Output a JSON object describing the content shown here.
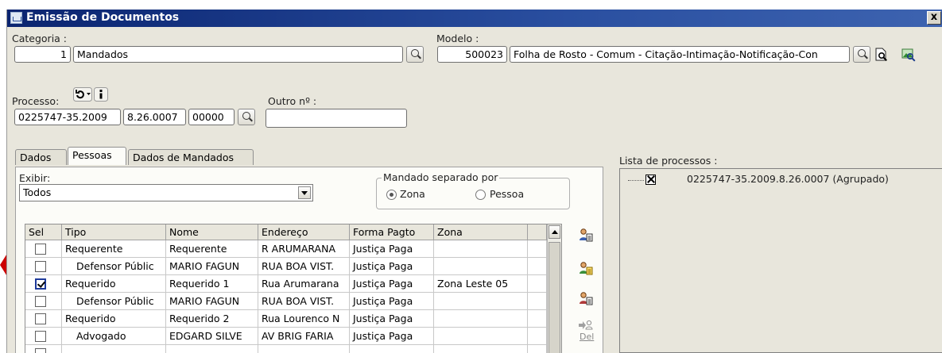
{
  "window": {
    "title": "Emissão de Documentos",
    "close_label": "x"
  },
  "categoria": {
    "label": "Categoria :",
    "code": "1",
    "name": "Mandados"
  },
  "modelo": {
    "label": "Modelo :",
    "code": "500023",
    "name": "Folha de Rosto - Comum - Citação-Intimação-Notificação-Con"
  },
  "processo": {
    "label": "Processo:",
    "part1": "0225747-35.2009",
    "part2": "8.26.0007",
    "part3": "00000"
  },
  "outro": {
    "label": "Outro nº :",
    "value": ""
  },
  "tabs": [
    {
      "label": "Dados"
    },
    {
      "label": "Pessoas"
    },
    {
      "label": "Dados de Mandados"
    }
  ],
  "exibir": {
    "label": "Exibir:",
    "value": "Todos"
  },
  "mandado_separado": {
    "label": "Mandado separado por",
    "options": [
      {
        "label": "Zona",
        "selected": true
      },
      {
        "label": "Pessoa",
        "selected": false
      }
    ]
  },
  "grid": {
    "columns": [
      "Sel",
      "Tipo",
      "Nome",
      "Endereço",
      "Forma Pagto",
      "Zona"
    ],
    "rows": [
      {
        "sel": false,
        "tipo": "Requerente",
        "nome": "Requerente",
        "endereco": "R ARUMARANA",
        "pagto": "Justiça Paga",
        "zona": ""
      },
      {
        "sel": false,
        "tipo": "Defensor Públic",
        "nome": "MARIO FAGUN",
        "endereco": "RUA BOA VIST.",
        "pagto": "Justiça Paga",
        "zona": ""
      },
      {
        "sel": true,
        "tipo": "Requerido",
        "nome": "Requerido 1",
        "endereco": "Rua Arumarana",
        "pagto": "Justiça Paga",
        "zona": "Zona Leste 05"
      },
      {
        "sel": false,
        "tipo": "Defensor Públic",
        "nome": "MARIO FAGUN",
        "endereco": "RUA BOA VIST.",
        "pagto": "Justiça Paga",
        "zona": ""
      },
      {
        "sel": false,
        "tipo": "Requerido",
        "nome": "Requerido 2",
        "endereco": "Rua Lourenco N",
        "pagto": "Justiça Paga",
        "zona": ""
      },
      {
        "sel": false,
        "tipo": "Advogado",
        "nome": "EDGARD SILVE",
        "endereco": "AV BRIG FARIA",
        "pagto": "Justiça Paga",
        "zona": ""
      },
      {
        "sel": false,
        "tipo": "",
        "nome": "",
        "endereco": "",
        "pagto": "",
        "zona": ""
      }
    ]
  },
  "side": {
    "del_label": "Del"
  },
  "lista": {
    "label": "Lista de processos :",
    "item": "0225747-35.2009.8.26.0007 (Agrupado)"
  },
  "colors": {
    "titlebar": "#0a2470",
    "window_bg": "#e8e6dc",
    "arrow": "#cc0000",
    "check_border": "#1e3a9a"
  }
}
